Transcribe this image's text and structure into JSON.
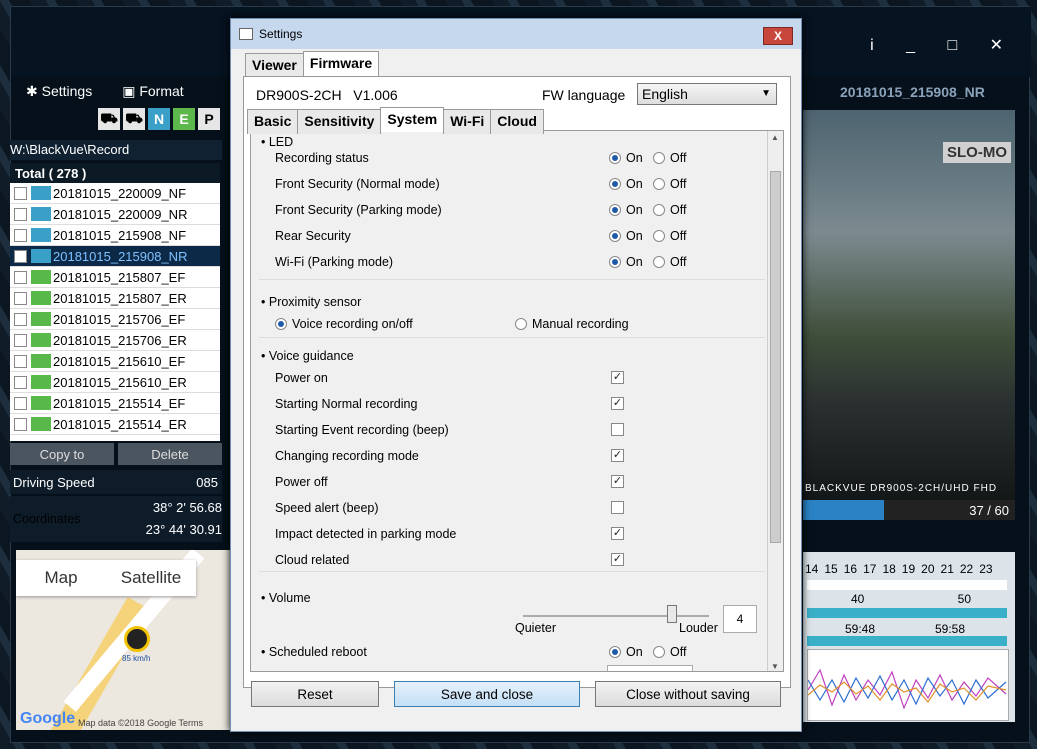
{
  "app": {
    "menu": {
      "settings": "Settings",
      "format": "Format"
    },
    "chips": [
      "N",
      "E",
      "P"
    ],
    "path": "W:\\BlackVue\\Record",
    "total": "Total ( 278 )",
    "files": [
      {
        "name": "20181015_220009_NF",
        "kind": "b"
      },
      {
        "name": "20181015_220009_NR",
        "kind": "b"
      },
      {
        "name": "20181015_215908_NF",
        "kind": "b"
      },
      {
        "name": "20181015_215908_NR",
        "kind": "b",
        "selected": true
      },
      {
        "name": "20181015_215807_EF",
        "kind": "g"
      },
      {
        "name": "20181015_215807_ER",
        "kind": "g"
      },
      {
        "name": "20181015_215706_EF",
        "kind": "g"
      },
      {
        "name": "20181015_215706_ER",
        "kind": "g"
      },
      {
        "name": "20181015_215610_EF",
        "kind": "g"
      },
      {
        "name": "20181015_215610_ER",
        "kind": "g"
      },
      {
        "name": "20181015_215514_EF",
        "kind": "g"
      },
      {
        "name": "20181015_215514_ER",
        "kind": "g"
      }
    ],
    "copy_to": "Copy to",
    "delete": "Delete",
    "driving_speed_label": "Driving Speed",
    "driving_speed_value": "085",
    "coordinates_label": "Coordinates",
    "coord_lat": "38° 2' 56.68",
    "coord_lon": "23° 44' 30.91",
    "map_tab": "Map",
    "satellite_tab": "Satellite",
    "map_speed": "85 km/h",
    "map_footer": "Map data ©2018 Google   Terms",
    "google": "Google",
    "current_file": "20181015_215908_NR",
    "slomo": "SLO-MO",
    "video_overlay": "BLACKVUE DR900S-2CH/UHD FHD",
    "video_count": "37 / 60",
    "progress": 0.38,
    "hours": [
      "14",
      "15",
      "16",
      "17",
      "18",
      "19",
      "20",
      "21",
      "22",
      "23"
    ],
    "minutes": [
      "40",
      "50"
    ],
    "seconds": [
      "59:48",
      "59:58"
    ]
  },
  "dialog": {
    "title": "Settings",
    "close": "X",
    "top_tabs": [
      "Viewer",
      "Firmware"
    ],
    "model": "DR900S-2CH",
    "version": "V1.006",
    "fw_language_label": "FW language",
    "fw_language": "English",
    "sub_tabs": [
      "Basic",
      "Sensitivity",
      "System",
      "Wi-Fi",
      "Cloud"
    ],
    "led_title": "LED",
    "on": "On",
    "off": "Off",
    "led_items": [
      {
        "label": "Recording status",
        "on": true
      },
      {
        "label": "Front Security (Normal mode)",
        "on": true
      },
      {
        "label": "Front Security (Parking mode)",
        "on": true
      },
      {
        "label": "Rear Security",
        "on": true
      },
      {
        "label": "Wi-Fi (Parking mode)",
        "on": true
      }
    ],
    "proximity_title": "Proximity sensor",
    "proximity_voice": "Voice recording on/off",
    "proximity_manual": "Manual recording",
    "voice_title": "Voice guidance",
    "voice_items": [
      {
        "label": "Power on",
        "checked": true
      },
      {
        "label": "Starting Normal recording",
        "checked": true
      },
      {
        "label": "Starting Event recording (beep)",
        "checked": false
      },
      {
        "label": "Changing recording mode",
        "checked": true
      },
      {
        "label": "Power off",
        "checked": true
      },
      {
        "label": "Speed alert (beep)",
        "checked": false
      },
      {
        "label": "Impact detected in parking mode",
        "checked": true
      },
      {
        "label": "Cloud related",
        "checked": true
      }
    ],
    "volume_label": "Volume",
    "volume_value": "4",
    "volume_fraction": 0.8,
    "quieter": "Quieter",
    "louder": "Louder",
    "reboot_label": "Scheduled reboot",
    "reset": "Reset",
    "save": "Save and close",
    "close_without": "Close without saving"
  }
}
